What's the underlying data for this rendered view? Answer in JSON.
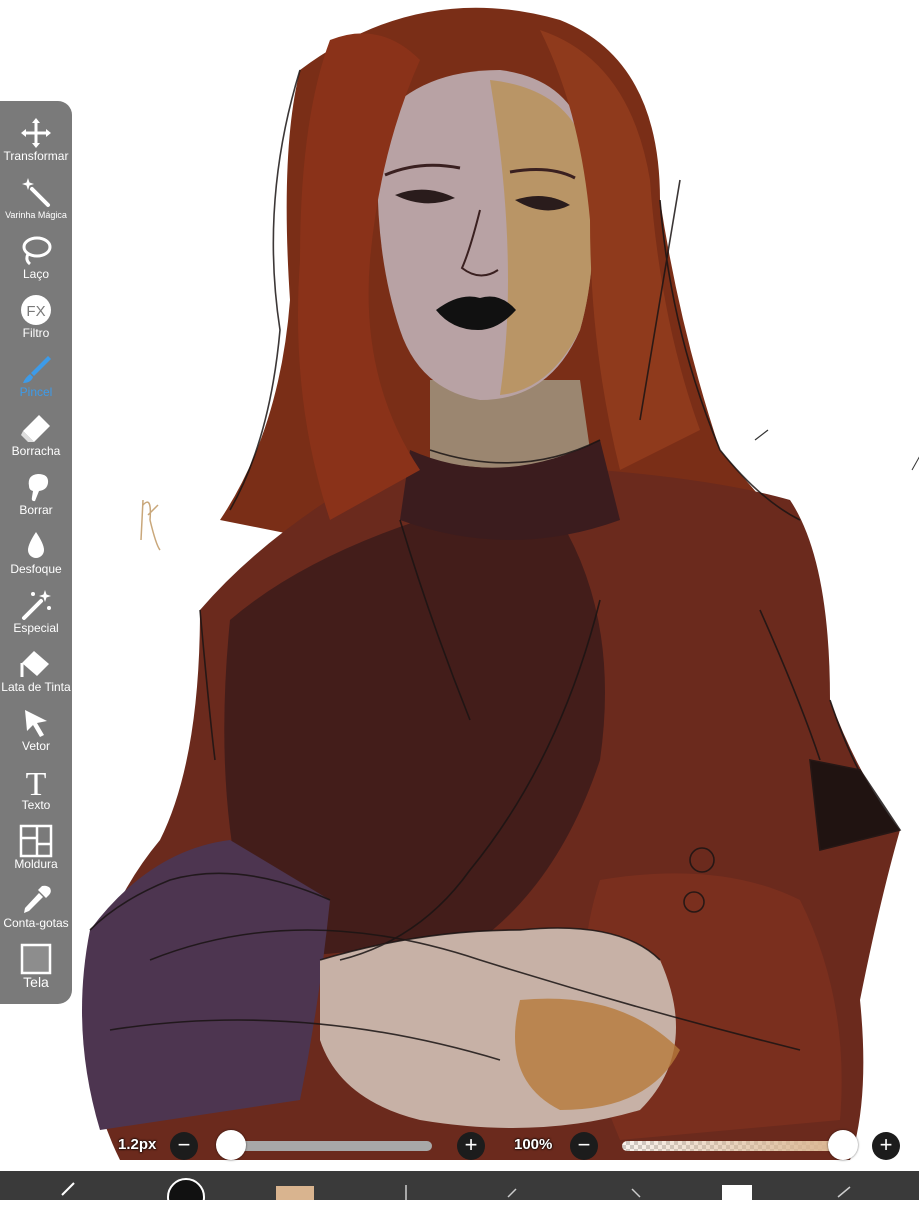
{
  "toolbar": {
    "tools": [
      {
        "label": "Transformar",
        "icon": "move-icon"
      },
      {
        "label": "Varinha Mágica",
        "icon": "magic-wand-icon"
      },
      {
        "label": "Laço",
        "icon": "lasso-icon"
      },
      {
        "label": "Filtro",
        "icon": "fx-icon",
        "glyph": "FX"
      },
      {
        "label": "Pincel",
        "icon": "brush-icon",
        "active": true
      },
      {
        "label": "Borracha",
        "icon": "eraser-icon"
      },
      {
        "label": "Borrar",
        "icon": "smudge-icon"
      },
      {
        "label": "Desfoque",
        "icon": "blur-drop-icon"
      },
      {
        "label": "Especial",
        "icon": "sparkle-wand-icon"
      },
      {
        "label": "Lata de Tinta",
        "icon": "paint-bucket-icon"
      },
      {
        "label": "Vetor",
        "icon": "vector-arrow-icon"
      },
      {
        "label": "Texto",
        "icon": "text-icon",
        "glyph": "T"
      },
      {
        "label": "Moldura",
        "icon": "frame-icon"
      },
      {
        "label": "Conta-gotas",
        "icon": "eyedropper-icon"
      },
      {
        "label": "Tela",
        "icon": "canvas-icon"
      }
    ],
    "active_color": "#3d9be9"
  },
  "brush_size": {
    "value": "1.2px",
    "level": 0.0
  },
  "opacity": {
    "value": "100%",
    "level": 1.0
  },
  "controls": {
    "minus": "−",
    "plus": "+"
  },
  "signature": "Mol#",
  "current_color": "#d9b48f"
}
